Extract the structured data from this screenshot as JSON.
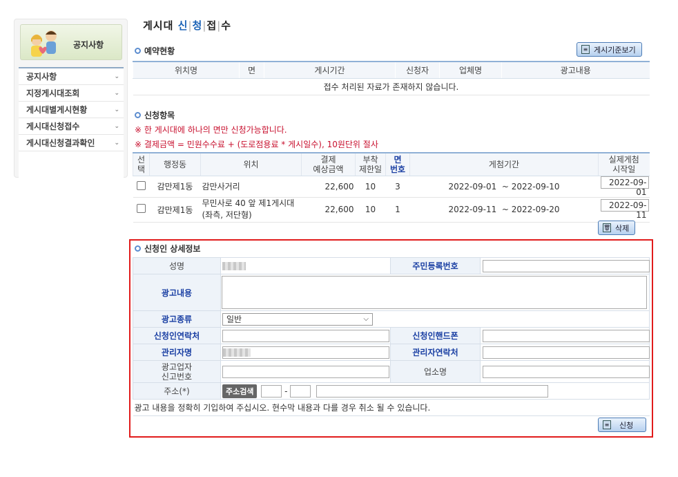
{
  "sidebar": {
    "banner_title": "공지사항",
    "items": [
      {
        "label": "공지사항"
      },
      {
        "label": "지정게시대조회"
      },
      {
        "label": "게시대별게시현황"
      },
      {
        "label": "게시대신청접수"
      },
      {
        "label": "게시대신청결과확인"
      }
    ]
  },
  "page": {
    "title_prefix": "게시대 ",
    "title_chars": [
      "신",
      "청",
      "접",
      "수"
    ]
  },
  "reservation": {
    "title": "예약현황",
    "button_label": "게시기준보기",
    "columns": [
      "위치명",
      "면",
      "게시기간",
      "신청자",
      "업체명",
      "광고내용"
    ],
    "empty_message": "접수 처리된 자료가 존재하지 않습니다."
  },
  "application_items": {
    "title": "신청항목",
    "warnings": [
      "※ 한 게시대에 하나의 면만 신청가능합니다.",
      "※ 결제금액 = 민원수수료 + (도로점용료 * 게시일수), 10원단위 절사"
    ],
    "columns": [
      "선\n택",
      "행정동",
      "위치",
      "결제\n예상금액",
      "부착\n제한일",
      "면\n번호",
      "게첨기간",
      "실제게첨\n시작일"
    ],
    "rows": [
      {
        "dong": "감만제1동",
        "location": "감만사거리",
        "amount": "22,600",
        "limit": "10",
        "face": "3",
        "period": "2022-09-01  ~ 2022-09-10",
        "start": "2022-09-01"
      },
      {
        "dong": "감만제1동",
        "location": "무민사로 40 앞 제1게시대(좌측, 저단형)",
        "amount": "22,600",
        "limit": "10",
        "face": "1",
        "period": "2022-09-11  ~ 2022-09-20",
        "start": "2022-09-11"
      }
    ],
    "delete_label": "삭제"
  },
  "applicant": {
    "title": "신청인 상세정보",
    "labels": {
      "name": "성명",
      "rrn": "주민등록번호",
      "ad_content": "광고내용",
      "ad_type": "광고종류",
      "contact": "신청인연락처",
      "mobile": "신청인핸드폰",
      "manager": "관리자명",
      "manager_contact": "관리자연락처",
      "biz_no": "광고업자\n신고번호",
      "biz_name": "업소명",
      "address": "주소(*)"
    },
    "ad_type_value": "일반",
    "address_search": "주소검색",
    "zip_sep": "-",
    "notice": "광고 내용을 정확히 기입하여 주십시오. 현수막 내용과 다를 경우 취소 될 수 있습니다.",
    "submit_label": "신청"
  }
}
